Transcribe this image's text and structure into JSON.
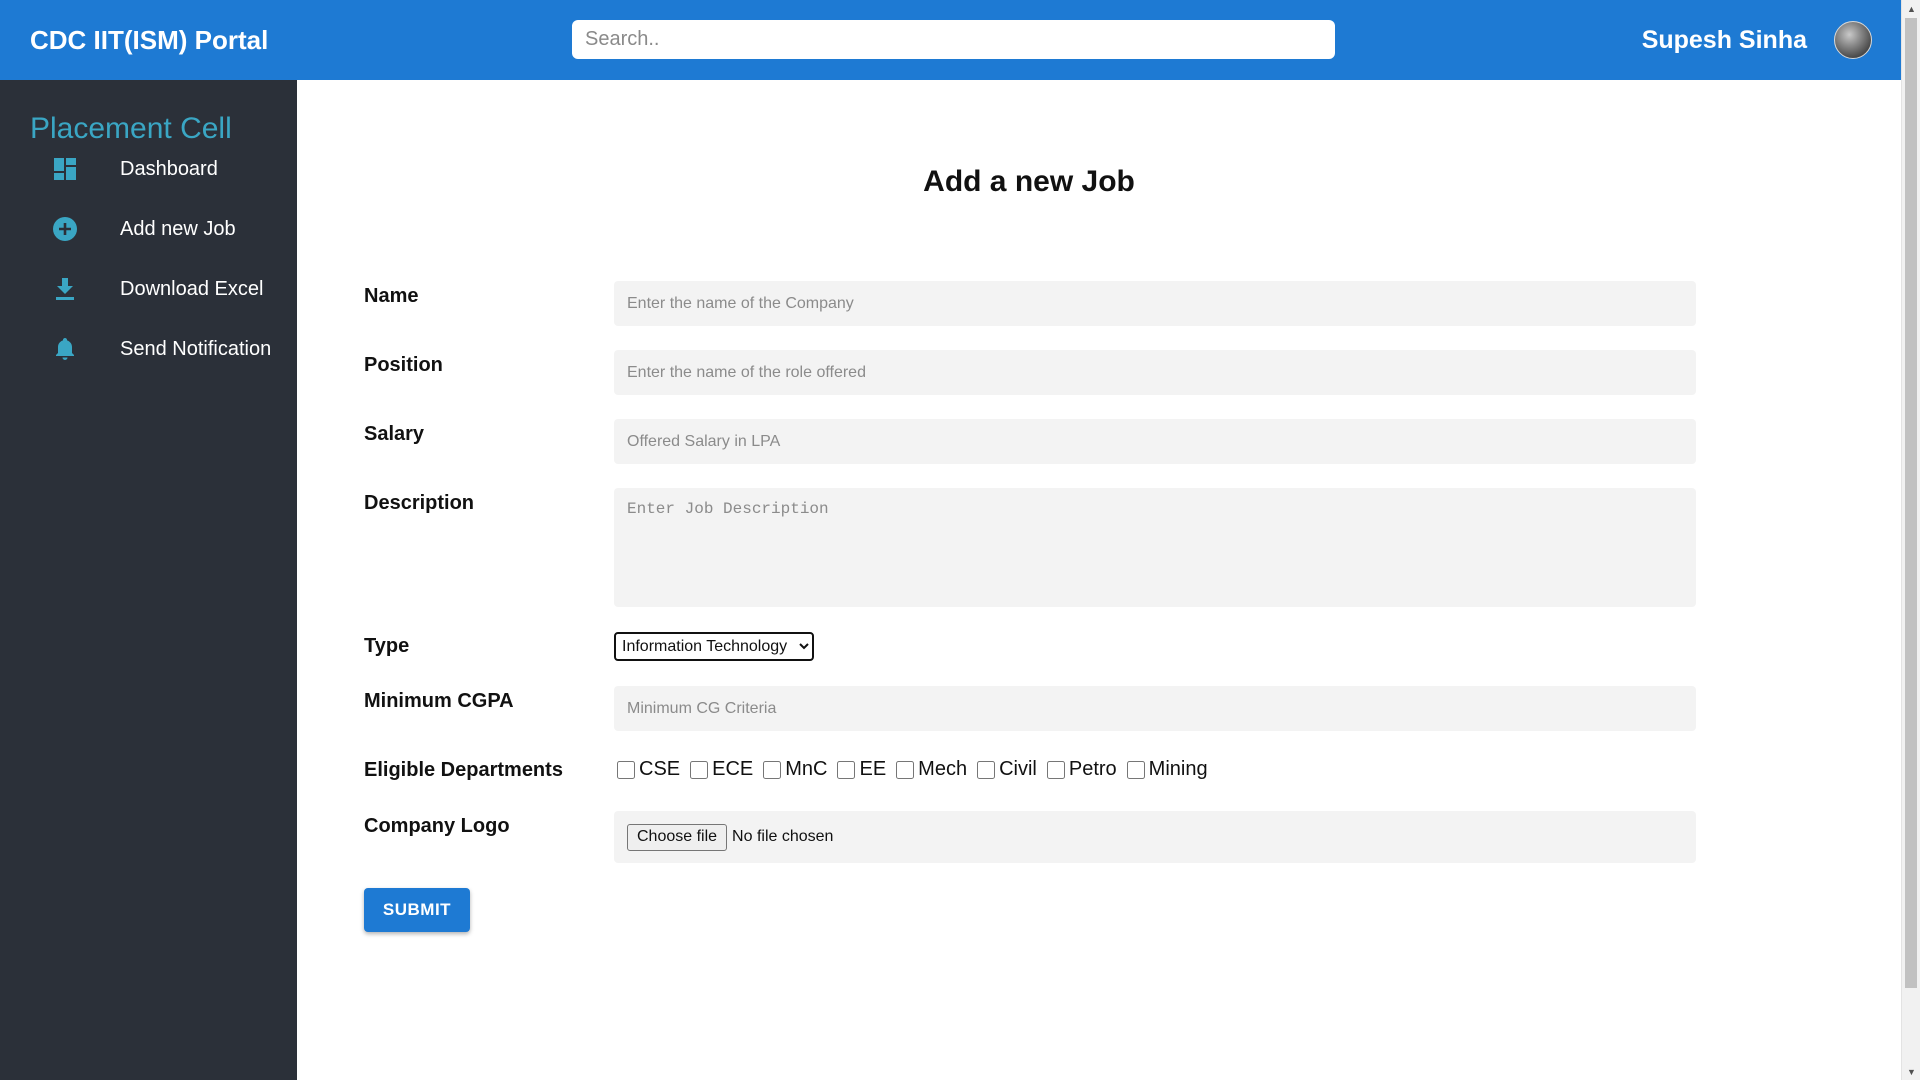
{
  "header": {
    "brand": "CDC IIT(ISM) Portal",
    "search_placeholder": "Search..",
    "user_name": "Supesh Sinha"
  },
  "sidebar": {
    "title": "Placement Cell",
    "items": [
      {
        "label": "Dashboard",
        "icon": "dashboard-icon"
      },
      {
        "label": "Add new Job",
        "icon": "add-circle-icon"
      },
      {
        "label": "Download Excel",
        "icon": "download-icon"
      },
      {
        "label": "Send Notification",
        "icon": "bell-icon"
      }
    ]
  },
  "form": {
    "title": "Add a new Job",
    "name": {
      "label": "Name",
      "placeholder": "Enter the name of the Company",
      "value": ""
    },
    "position": {
      "label": "Position",
      "placeholder": "Enter the name of the role offered",
      "value": ""
    },
    "salary": {
      "label": "Salary",
      "placeholder": "Offered Salary in LPA",
      "value": ""
    },
    "description": {
      "label": "Description",
      "placeholder": "Enter Job Description",
      "value": ""
    },
    "type": {
      "label": "Type",
      "selected": "Information Technology"
    },
    "min_cgpa": {
      "label": "Minimum CGPA",
      "placeholder": "Minimum CG Criteria",
      "value": ""
    },
    "departments": {
      "label": "Eligible Departments",
      "options": [
        "CSE",
        "ECE",
        "MnC",
        "EE",
        "Mech",
        "Civil",
        "Petro",
        "Mining"
      ]
    },
    "logo": {
      "label": "Company Logo",
      "button": "Choose file",
      "status": "No file chosen"
    },
    "submit": "SUBMIT"
  },
  "colors": {
    "topbar": "#1e7ad3",
    "sidebar": "#2b3039",
    "sidebar_accent": "#3aa6c4",
    "submit": "#1e7ad3"
  }
}
